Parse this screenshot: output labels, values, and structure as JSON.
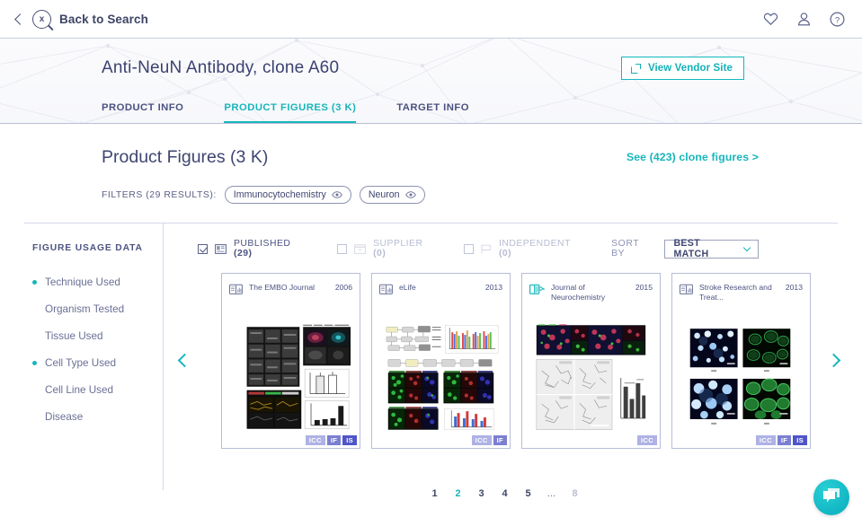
{
  "topbar": {
    "back_label": "Back to Search",
    "logo_icon": "search-dna-logo-icon",
    "icons": [
      {
        "name": "favorites-heart-icon",
        "glyph": "heart"
      },
      {
        "name": "user-account-icon",
        "glyph": "user"
      },
      {
        "name": "help-question-icon",
        "glyph": "question"
      }
    ]
  },
  "hero": {
    "title": "Anti-NeuN Antibody, clone A60",
    "vendor_button": "View Vendor Site",
    "vendor_icon": "external-link-icon",
    "tabs": [
      {
        "label": "PRODUCT INFO",
        "active": false
      },
      {
        "label": "PRODUCT FIGURES (3 K)",
        "active": true
      },
      {
        "label": "TARGET INFO",
        "active": false
      }
    ]
  },
  "results": {
    "page_title": "Product Figures (3 K)",
    "clone_link": "See (423) clone figures >",
    "filters_label": "FILTERS (29 RESULTS):",
    "filters": [
      {
        "label": "Immunocytochemistry",
        "icon": "eye-icon"
      },
      {
        "label": "Neuron",
        "icon": "eye-icon"
      }
    ]
  },
  "sidebar": {
    "title": "FIGURE USAGE DATA",
    "items": [
      {
        "label": "Technique Used",
        "selected": true
      },
      {
        "label": "Organism Tested",
        "selected": false
      },
      {
        "label": "Tissue Used",
        "selected": false
      },
      {
        "label": "Cell Type Used",
        "selected": true
      },
      {
        "label": "Cell Line Used",
        "selected": false
      },
      {
        "label": "Disease",
        "selected": false
      }
    ]
  },
  "toolbar": {
    "sources": [
      {
        "label": "PUBLISHED",
        "count": "(29)",
        "checked": true,
        "dim": false,
        "icon": "journal-icon"
      },
      {
        "label": "SUPPLIER",
        "count": "(0)",
        "checked": false,
        "dim": true,
        "icon": "box-icon"
      },
      {
        "label": "INDEPENDENT",
        "count": "(0)",
        "checked": false,
        "dim": true,
        "icon": "flag-icon"
      }
    ],
    "sort_label": "SORT BY",
    "sort_value": "BEST MATCH",
    "sort_caret_icon": "chevron-down-icon"
  },
  "carousel": {
    "prev_icon": "chevron-left-icon",
    "next_icon": "chevron-right-icon",
    "cards": [
      {
        "journal": "The EMBO Journal",
        "year": "2006",
        "icon": "journal-book-icon",
        "open_access": false,
        "badges": [
          "ICC",
          "IF",
          "IS"
        ],
        "thumb": "microscopy-montage-dark"
      },
      {
        "journal": "eLife",
        "year": "2013",
        "icon": "journal-book-icon",
        "open_access": false,
        "badges": [
          "ICC",
          "IF"
        ],
        "thumb": "diagram-and-fluorescence-panels"
      },
      {
        "journal": "Journal of Neurochemistry",
        "year": "2015",
        "icon": "journal-open-access-icon",
        "open_access": true,
        "badges": [
          "ICC"
        ],
        "thumb": "fluorescence-and-brightfield-panels"
      },
      {
        "journal": "Stroke Research and Treat...",
        "year": "2013",
        "icon": "journal-book-icon",
        "open_access": false,
        "badges": [
          "ICC",
          "IF",
          "IS"
        ],
        "thumb": "dapi-green-quad-panels"
      }
    ]
  },
  "pagination": {
    "pages": [
      "1",
      "2",
      "3",
      "4",
      "5",
      "...",
      "8"
    ],
    "active": "2"
  },
  "chat": {
    "icon": "chat-bubbles-icon"
  },
  "colors": {
    "accent_teal": "#17b6bb",
    "text_navy": "#3d4466",
    "muted": "#8d93b4",
    "badge_icc": "#aeb2e4",
    "badge_if": "#7b7fd1",
    "badge_is": "#4f55c9"
  }
}
